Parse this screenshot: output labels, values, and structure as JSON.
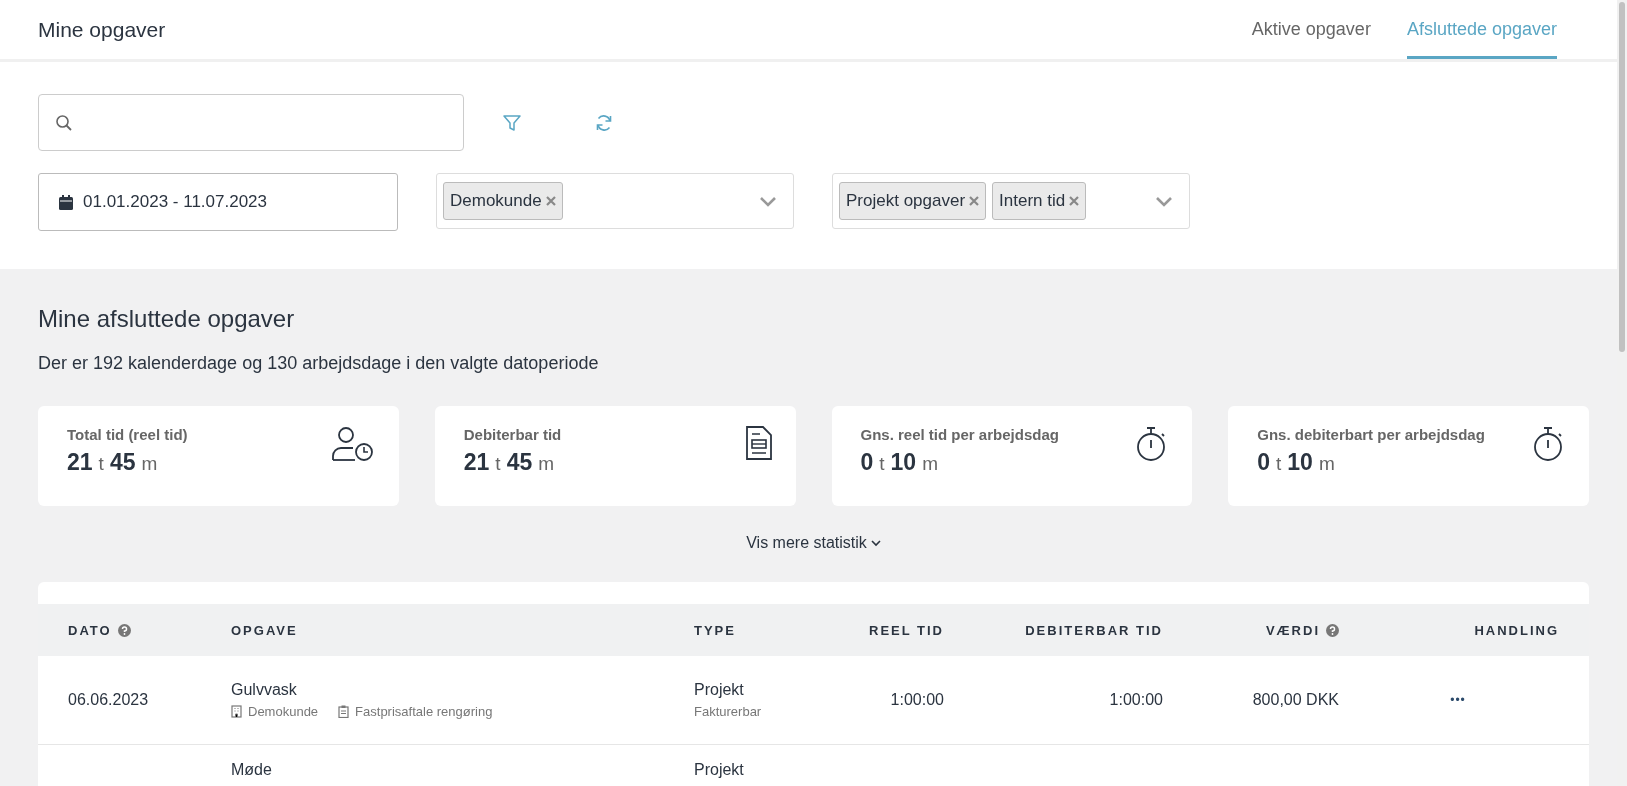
{
  "header": {
    "title": "Mine opgaver",
    "tabs": [
      {
        "label": "Aktive opgaver",
        "selected": false
      },
      {
        "label": "Afsluttede opgaver",
        "selected": true
      }
    ]
  },
  "filters": {
    "date_range": "01.01.2023 - 11.07.2023",
    "customers": {
      "tags": [
        "Demokunde"
      ]
    },
    "task_types": {
      "tags": [
        "Projekt opgaver",
        "Intern tid"
      ]
    }
  },
  "summary": {
    "title": "Mine afsluttede opgaver",
    "subtitle": "Der er 192 kalenderdage og 130 arbejdsdage i den valgte datoperiode",
    "cards": [
      {
        "label": "Total tid (reel tid)",
        "kind": "person-clock",
        "hours": "21",
        "hour_unit": "t",
        "minutes": "45",
        "minute_unit": "m"
      },
      {
        "label": "Debiterbar tid",
        "kind": "document",
        "hours": "21",
        "hour_unit": "t",
        "minutes": "45",
        "minute_unit": "m"
      },
      {
        "label": "Gns. reel tid per arbejdsdag",
        "kind": "stopwatch",
        "hours": "0",
        "hour_unit": "t",
        "minutes": "10",
        "minute_unit": "m"
      },
      {
        "label": "Gns. debiterbart per arbejdsdag",
        "kind": "stopwatch",
        "hours": "0",
        "hour_unit": "t",
        "minutes": "10",
        "minute_unit": "m"
      }
    ],
    "more_link": "Vis mere statistik"
  },
  "table": {
    "columns": [
      {
        "label": "DATO",
        "help": true
      },
      {
        "label": "OPGAVE",
        "help": false
      },
      {
        "label": "TYPE",
        "help": false
      },
      {
        "label": "REEL TID",
        "help": false
      },
      {
        "label": "DEBITERBAR TID",
        "help": false
      },
      {
        "label": "VÆRDI",
        "help": true
      },
      {
        "label": "HANDLING",
        "help": false
      }
    ],
    "rows": [
      {
        "date": "06.06.2023",
        "task": "Gulvvask",
        "customer": "Demokunde",
        "agreement": "Fastprisaftale rengøring",
        "type": "Projekt",
        "type_note": "Fakturerbar",
        "real_time": "1:00:00",
        "billable_time": "1:00:00",
        "value": "800,00 DKK",
        "action": "•••"
      },
      {
        "task": "Møde",
        "type": "Projekt"
      }
    ]
  }
}
